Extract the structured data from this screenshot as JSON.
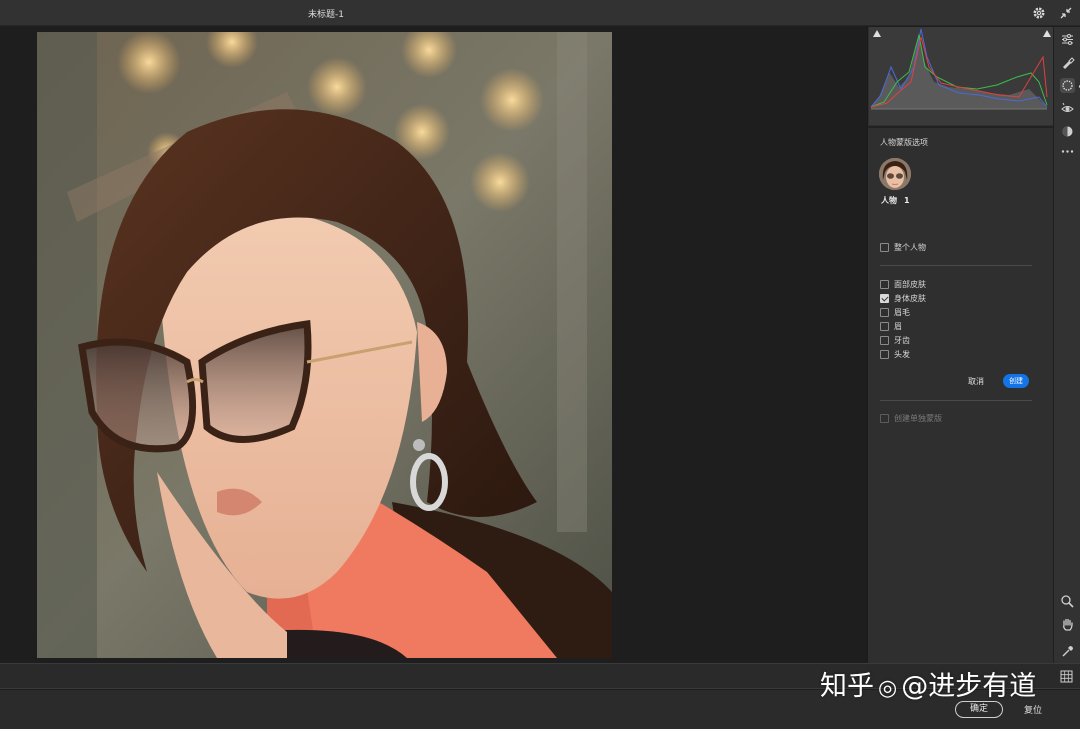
{
  "window": {
    "title": "未标题-1"
  },
  "panel": {
    "section_title": "人物蒙版选项",
    "person": {
      "label": "人物",
      "number": "1"
    },
    "whole_person": {
      "label": "整个人物",
      "checked": false
    },
    "parts": [
      {
        "label": "面部皮肤",
        "checked": false
      },
      {
        "label": "身体皮肤",
        "checked": true
      },
      {
        "label": "眉毛",
        "checked": false
      },
      {
        "label": "眉",
        "checked": false
      },
      {
        "label": "牙齿",
        "checked": false
      },
      {
        "label": "头发",
        "checked": false
      }
    ],
    "cancel_label": "取消",
    "create_label": "创建",
    "separate_masks": {
      "label": "创建单独蒙版",
      "checked": false
    }
  },
  "footer": {
    "ok_label": "确定",
    "reset_label": "复位"
  },
  "watermark": {
    "brand": "知乎",
    "handle": "@进步有道"
  },
  "colors": {
    "accent": "#1473e6",
    "panel_bg": "#2f2f2f",
    "mask_overlay": "#ff4a2e"
  },
  "icons": {
    "top": [
      "gear-icon",
      "collapse-icon"
    ],
    "tools": [
      "edit-sliders-icon",
      "healing-brush-icon",
      "masking-icon",
      "red-eye-icon",
      "presets-icon",
      "more-icon"
    ],
    "bottom_tools": [
      "zoom-icon",
      "hand-icon",
      "eyedropper-icon",
      "grid-icon"
    ]
  }
}
